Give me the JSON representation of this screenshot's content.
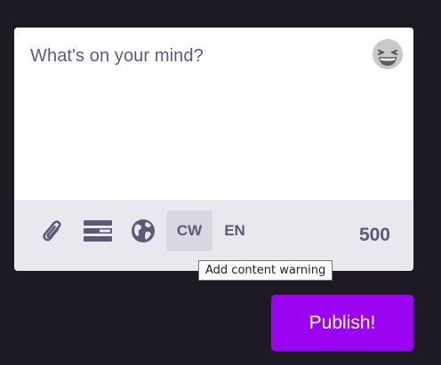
{
  "compose": {
    "placeholder": "What's on your mind?",
    "emoji_icon": "grinning-squinting-face-icon"
  },
  "toolbar": {
    "attach_icon": "paperclip-icon",
    "poll_icon": "poll-icon",
    "visibility_icon": "globe-icon",
    "cw_label": "CW",
    "language_label": "EN",
    "character_counter": "500"
  },
  "tooltip": {
    "text": "Add content warning"
  },
  "publish": {
    "label": "Publish!"
  },
  "colors": {
    "background": "#1d1a24",
    "toolbar": "#e8e8ee",
    "accent": "#9a04f1",
    "placeholder": "#5d5a82"
  }
}
